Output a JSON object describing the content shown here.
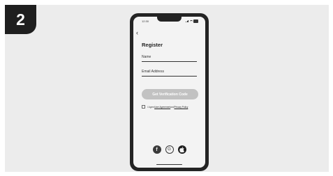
{
  "step": {
    "number": "2"
  },
  "status_bar": {
    "time": "12:30"
  },
  "register": {
    "title": "Register",
    "name_placeholder": "Name",
    "email_placeholder": "Email Address",
    "verify_button": "Get Verification Code",
    "agree_prefix": "I Agree ",
    "user_agreement": "User Agreement",
    "agree_and": " and ",
    "privacy_policy": "Privacy Policy"
  },
  "social": {
    "facebook_glyph": "f",
    "google_glyph": "G",
    "apple_glyph": ""
  },
  "colors": {
    "phone_frame": "#232323",
    "screen_bg": "#f3f3f3",
    "button_bg": "#c2c2c2",
    "panel_bg": "#ececec"
  }
}
